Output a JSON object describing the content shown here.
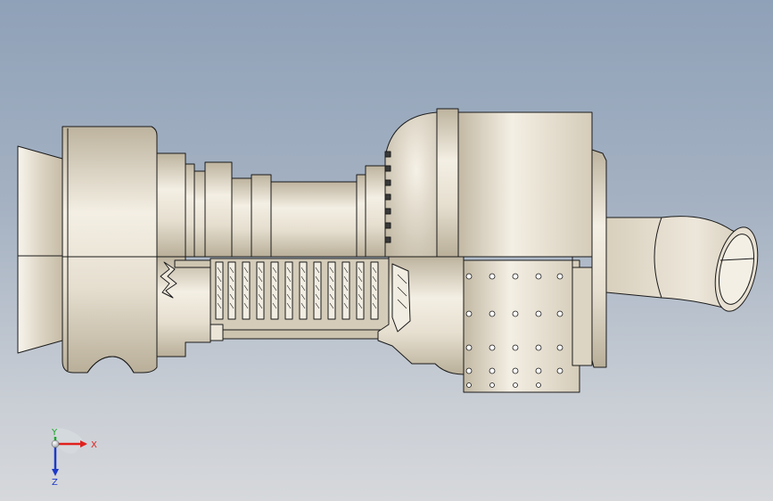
{
  "viewport": {
    "model": "turbojet-engine-section-view"
  },
  "triad": {
    "x_label": "X",
    "y_label": "Y",
    "z_label": "Z",
    "colors": {
      "x": "#e0201c",
      "y": "#1aa829",
      "z": "#1c39c9"
    }
  },
  "colors": {
    "part_fill": "#e3dccd",
    "part_shade": "#c9c0ac",
    "part_highlight": "#f7f3ea",
    "edge": "#1a1a1a"
  }
}
